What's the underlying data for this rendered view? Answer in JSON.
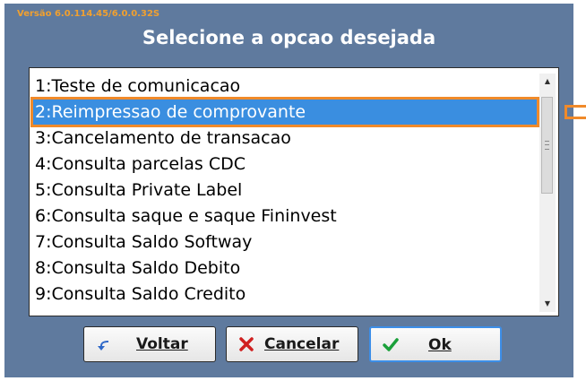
{
  "version_text": "Versão 6.0.114.45/6.0.0.32S",
  "title": "Selecione a opcao desejada",
  "list": {
    "items": [
      "1:Teste de comunicacao",
      "2:Reimpressao de comprovante",
      "3:Cancelamento de transacao",
      "4:Consulta parcelas CDC",
      "5:Consulta Private Label",
      "6:Consulta saque e saque Fininvest",
      "7:Consulta Saldo Softway",
      "8:Consulta Saldo Debito",
      "9:Consulta Saldo Credito"
    ],
    "selected_index": 1
  },
  "buttons": {
    "voltar": {
      "label": "Voltar",
      "icon": "back-arrow-icon"
    },
    "cancelar": {
      "label": "Cancelar",
      "icon": "red-x-icon"
    },
    "ok": {
      "label": "Ok",
      "icon": "green-check-icon"
    }
  },
  "colors": {
    "dialog_bg": "#5f7a9e",
    "selection": "#3a8ee0",
    "highlight_border": "#f08a2a",
    "version_text": "#f0a030"
  }
}
